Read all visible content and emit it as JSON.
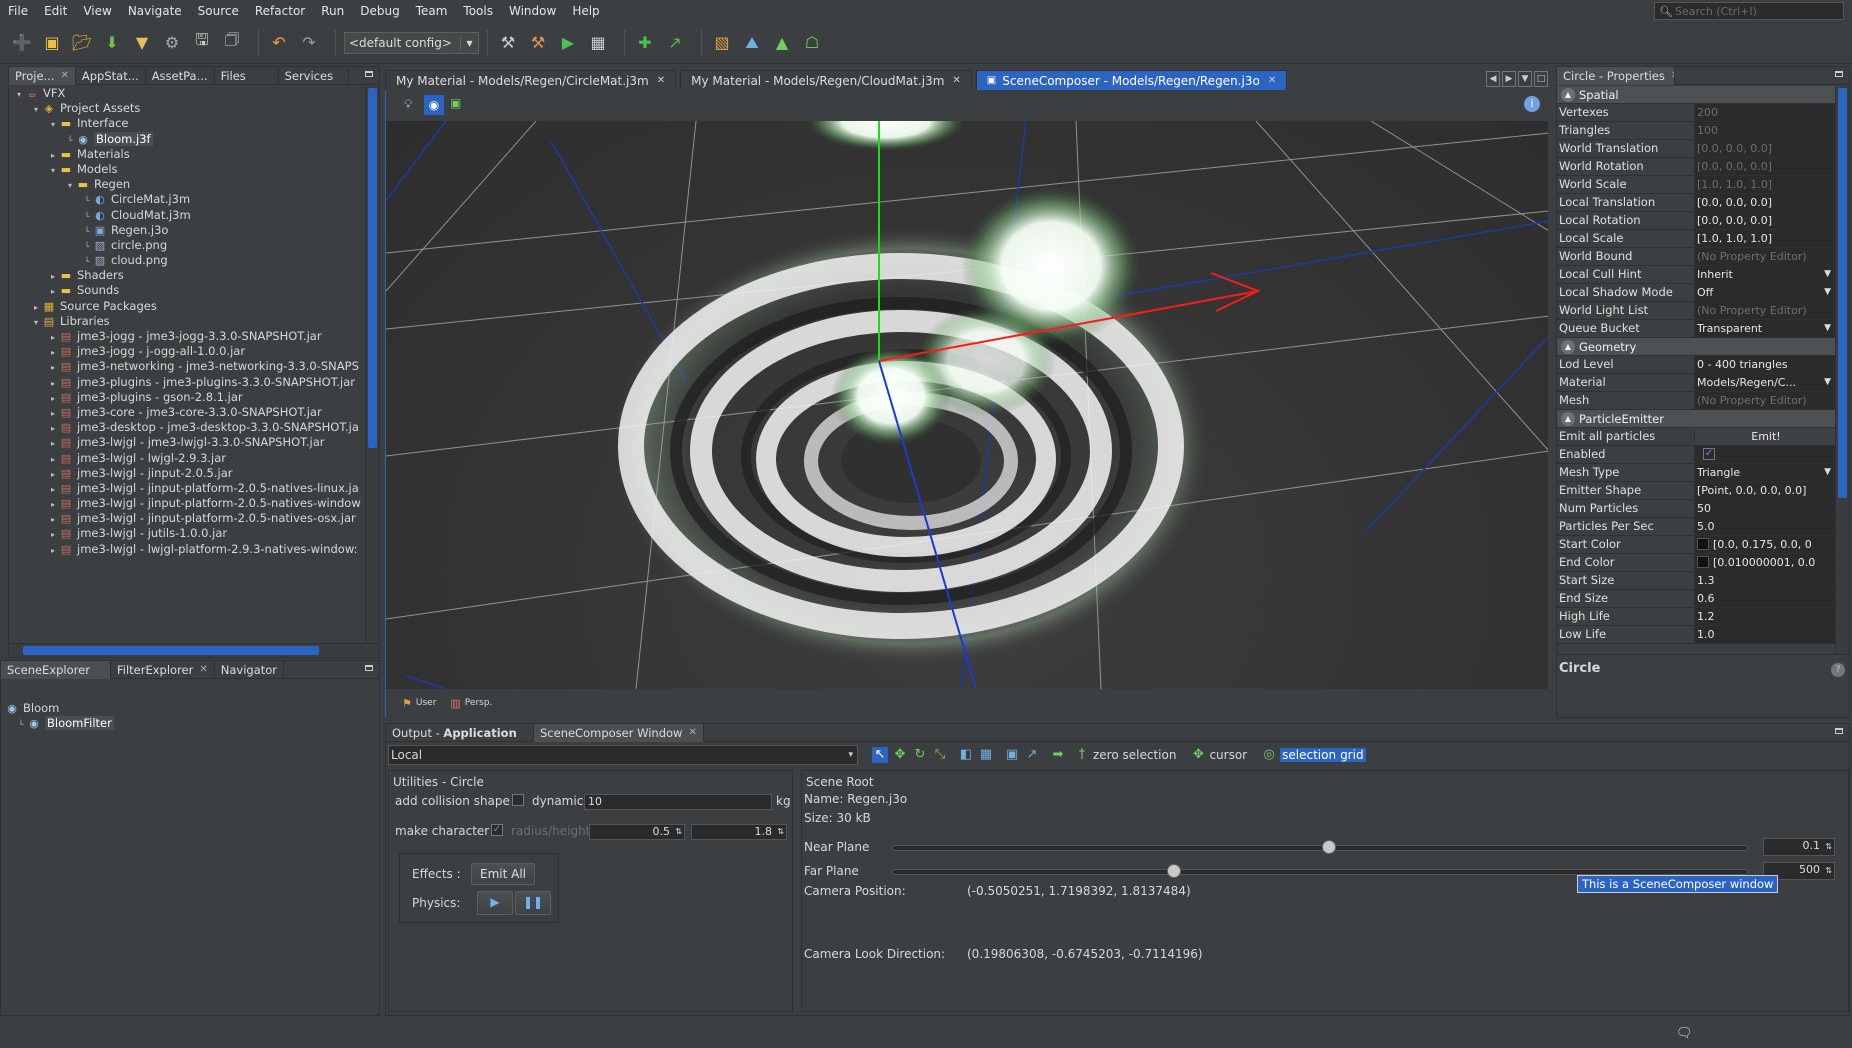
{
  "menu": [
    "File",
    "Edit",
    "View",
    "Navigate",
    "Source",
    "Refactor",
    "Run",
    "Debug",
    "Team",
    "Tools",
    "Window",
    "Help"
  ],
  "search": {
    "placeholder": "Search (Ctrl+I)"
  },
  "toolbar": {
    "config": "<default config>"
  },
  "project_panel": {
    "tabs": [
      "Proje...",
      "AppStat...",
      "AssetPa...",
      "Files",
      "Services"
    ],
    "tree": [
      {
        "label": "VFX",
        "depth": 0,
        "icon": "project-icon",
        "tw": "open"
      },
      {
        "label": "Project Assets",
        "depth": 1,
        "icon": "assets-icon",
        "tw": "open"
      },
      {
        "label": "Interface",
        "depth": 2,
        "icon": "folder-icon",
        "tw": "open"
      },
      {
        "label": "Bloom.j3f",
        "depth": 3,
        "icon": "eye-icon",
        "tw": "none",
        "selected": true
      },
      {
        "label": "Materials",
        "depth": 2,
        "icon": "folder-icon",
        "tw": "closed"
      },
      {
        "label": "Models",
        "depth": 2,
        "icon": "folder-icon",
        "tw": "open"
      },
      {
        "label": "Regen",
        "depth": 3,
        "icon": "folder-icon",
        "tw": "open"
      },
      {
        "label": "CircleMat.j3m",
        "depth": 4,
        "icon": "material-icon",
        "tw": "none"
      },
      {
        "label": "CloudMat.j3m",
        "depth": 4,
        "icon": "material-icon",
        "tw": "none"
      },
      {
        "label": "Regen.j3o",
        "depth": 4,
        "icon": "model-icon",
        "tw": "none"
      },
      {
        "label": "circle.png",
        "depth": 4,
        "icon": "image-icon",
        "tw": "none"
      },
      {
        "label": "cloud.png",
        "depth": 4,
        "icon": "image-icon",
        "tw": "none"
      },
      {
        "label": "Shaders",
        "depth": 2,
        "icon": "folder-icon",
        "tw": "closed"
      },
      {
        "label": "Sounds",
        "depth": 2,
        "icon": "folder-icon",
        "tw": "closed"
      },
      {
        "label": "Source Packages",
        "depth": 1,
        "icon": "package-icon",
        "tw": "closed"
      },
      {
        "label": "Libraries",
        "depth": 1,
        "icon": "library-icon",
        "tw": "open"
      },
      {
        "label": "jme3-jogg - jme3-jogg-3.3.0-SNAPSHOT.jar",
        "depth": 2,
        "icon": "jar-icon",
        "tw": "closed"
      },
      {
        "label": "jme3-jogg - j-ogg-all-1.0.0.jar",
        "depth": 2,
        "icon": "jar-icon",
        "tw": "closed"
      },
      {
        "label": "jme3-networking - jme3-networking-3.3.0-SNAPS",
        "depth": 2,
        "icon": "jar-icon",
        "tw": "closed"
      },
      {
        "label": "jme3-plugins - jme3-plugins-3.3.0-SNAPSHOT.jar",
        "depth": 2,
        "icon": "jar-icon",
        "tw": "closed"
      },
      {
        "label": "jme3-plugins - gson-2.8.1.jar",
        "depth": 2,
        "icon": "jar-icon",
        "tw": "closed"
      },
      {
        "label": "jme3-core - jme3-core-3.3.0-SNAPSHOT.jar",
        "depth": 2,
        "icon": "jar-icon",
        "tw": "closed"
      },
      {
        "label": "jme3-desktop - jme3-desktop-3.3.0-SNAPSHOT.ja",
        "depth": 2,
        "icon": "jar-icon",
        "tw": "closed"
      },
      {
        "label": "jme3-lwjgl - jme3-lwjgl-3.3.0-SNAPSHOT.jar",
        "depth": 2,
        "icon": "jar-icon",
        "tw": "closed"
      },
      {
        "label": "jme3-lwjgl - lwjgl-2.9.3.jar",
        "depth": 2,
        "icon": "jar-icon",
        "tw": "closed"
      },
      {
        "label": "jme3-lwjgl - jinput-2.0.5.jar",
        "depth": 2,
        "icon": "jar-icon",
        "tw": "closed"
      },
      {
        "label": "jme3-lwjgl - jinput-platform-2.0.5-natives-linux.ja",
        "depth": 2,
        "icon": "jar-icon",
        "tw": "closed"
      },
      {
        "label": "jme3-lwjgl - jinput-platform-2.0.5-natives-window",
        "depth": 2,
        "icon": "jar-icon",
        "tw": "closed"
      },
      {
        "label": "jme3-lwjgl - jinput-platform-2.0.5-natives-osx.jar",
        "depth": 2,
        "icon": "jar-icon",
        "tw": "closed"
      },
      {
        "label": "jme3-lwjgl - jutils-1.0.0.jar",
        "depth": 2,
        "icon": "jar-icon",
        "tw": "closed"
      },
      {
        "label": "jme3-lwjgl - lwjgl-platform-2.9.3-natives-window:",
        "depth": 2,
        "icon": "jar-icon",
        "tw": "closed"
      }
    ]
  },
  "editor": {
    "tabs": [
      {
        "label": "My Material - Models/Regen/CircleMat.j3m",
        "active": false
      },
      {
        "label": "My Material - Models/Regen/CloudMat.j3m",
        "active": false
      },
      {
        "label": "SceneComposer - Models/Regen/Regen.j3o",
        "active": true
      }
    ],
    "view_user": "User",
    "view_persp": "Persp."
  },
  "properties": {
    "tab": "Circle - Properties",
    "sections": [
      {
        "title": "Spatial",
        "rows": [
          {
            "k": "Vertexes",
            "v": "200",
            "dis": true
          },
          {
            "k": "Triangles",
            "v": "100",
            "dis": true
          },
          {
            "k": "World Translation",
            "v": "[0.0, 0.0, 0.0]",
            "dis": true
          },
          {
            "k": "World Rotation",
            "v": "[0.0, 0.0, 0.0]",
            "dis": true
          },
          {
            "k": "World Scale",
            "v": "[1.0, 1.0, 1.0]",
            "dis": true
          },
          {
            "k": "Local Translation",
            "v": "[0.0, 0.0, 0.0]"
          },
          {
            "k": "Local Rotation",
            "v": "[0.0, 0.0, 0.0]"
          },
          {
            "k": "Local Scale",
            "v": "[1.0, 1.0, 1.0]"
          },
          {
            "k": "World Bound",
            "v": "(No Property Editor)",
            "dis": true
          },
          {
            "k": "Local Cull Hint",
            "v": "Inherit",
            "dd": true
          },
          {
            "k": "Local Shadow Mode",
            "v": "Off",
            "dd": true
          },
          {
            "k": "World Light List",
            "v": "(No Property Editor)",
            "dis": true
          },
          {
            "k": "Queue Bucket",
            "v": "Transparent",
            "dd": true
          }
        ]
      },
      {
        "title": "Geometry",
        "rows": [
          {
            "k": "Lod Level",
            "v": "0 - 400 triangles"
          },
          {
            "k": "Material",
            "v": "Models/Regen/C...",
            "dd": true
          },
          {
            "k": "Mesh",
            "v": "(No Property Editor)",
            "dis": true
          }
        ]
      },
      {
        "title": "ParticleEmitter",
        "rows": [
          {
            "k": "Emit all particles",
            "v": "Emit!",
            "btn": true
          },
          {
            "k": "Enabled",
            "v": "",
            "chk": true
          },
          {
            "k": "Mesh Type",
            "v": "Triangle",
            "dd": true
          },
          {
            "k": "Emitter Shape",
            "v": "[Point, 0.0, 0.0, 0.0]"
          },
          {
            "k": "Num Particles",
            "v": "50"
          },
          {
            "k": "Particles Per Sec",
            "v": "5.0"
          },
          {
            "k": "Start Color",
            "v": "[0.0, 0.175, 0.0, 0",
            "sw": true
          },
          {
            "k": "End Color",
            "v": "[0.010000001, 0.0",
            "sw": true
          },
          {
            "k": "Start Size",
            "v": "1.3"
          },
          {
            "k": "End Size",
            "v": "0.6"
          },
          {
            "k": "High Life",
            "v": "1.2"
          },
          {
            "k": "Low Life",
            "v": "1.0"
          }
        ]
      }
    ],
    "footer_title": "Circle"
  },
  "scene_explorer": {
    "tabs": [
      "SceneExplorer",
      "FilterExplorer",
      "Navigator"
    ],
    "items": [
      {
        "label": "Bloom",
        "depth": 0
      },
      {
        "label": "BloomFilter",
        "depth": 1,
        "selected": true
      }
    ]
  },
  "output": {
    "tab_prefix": "Output - ",
    "tab_app": "Application",
    "tab2": "SceneComposer Window",
    "local": "Local",
    "zero_selection": "zero selection",
    "cursor": "cursor",
    "selection": "selection",
    "grid": "grid",
    "utilities": {
      "title": "Utilities - Circle",
      "add_collision": "add collision shape",
      "dynamic": "dynamic:",
      "dynamic_val": "10",
      "kg": "kg",
      "make_character": "make character",
      "radius_height": "radius/height",
      "radius": "0.5",
      "height": "1.8",
      "effects": "Effects :",
      "emit_all": "Emit All",
      "physics": "Physics:"
    },
    "scene_root": {
      "title": "Scene Root",
      "name": "Name: Regen.j3o",
      "size": "Size: 30 kB",
      "near_plane": "Near Plane",
      "near_val": "0.1",
      "near_level": 0.51,
      "far_plane": "Far Plane",
      "far_val": "500",
      "far_level": 0.33,
      "cam_pos_label": "Camera Position:",
      "cam_pos": "(-0.5050251, 1.7198392, 1.8137484)",
      "cam_look_label": "Camera Look Direction:",
      "cam_look": "(0.19806308, -0.6745203, -0.7114196)",
      "tooltip": "This is a SceneComposer window"
    }
  }
}
